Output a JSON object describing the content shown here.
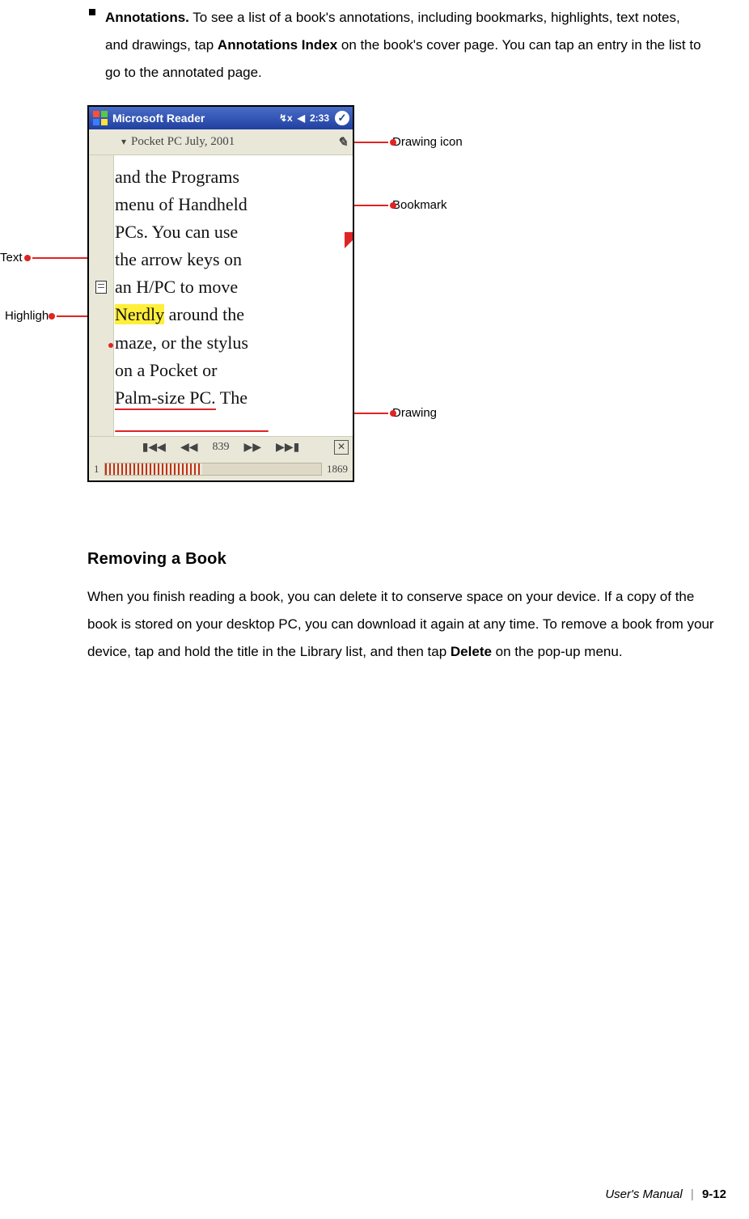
{
  "bullet": {
    "label": "Annotations.",
    "text_before": " To see a list of a book's annotations, including bookmarks, highlights, text notes, and drawings, tap ",
    "bold_cmd": "Annotations Index",
    "text_after": " on the book's cover page. You can tap an entry in the list to go to the annotated page."
  },
  "device": {
    "titlebar": {
      "app_name": "Microsoft Reader",
      "time": "2:33",
      "conn_icon": "↯x",
      "volume_icon": "◀"
    },
    "book_header_arrow": "▾",
    "book_header": "Pocket PC July, 2001",
    "pen_glyph": "✎",
    "text_line1": "and the Programs",
    "text_line2": "menu of Handheld",
    "text_line3": "PCs. You can use",
    "text_line4": "the arrow keys on",
    "text_line5": "an H/PC to move",
    "text_hl_word": "Nerdly",
    "text_line6_rest": " around the",
    "text_line7": "maze, or the stylus",
    "text_line8": "on a Pocket or",
    "text_underlined": "Palm-size PC.",
    "text_line9_rest": " The",
    "nav_first": "▮◀◀",
    "nav_back": "◀◀",
    "nav_page": "839",
    "nav_fwd": "▶▶",
    "nav_last": "▶▶▮",
    "nav_close": "✕",
    "prog_start": "1",
    "prog_end": "1869",
    "prog_fill_pct": "45%"
  },
  "callouts": {
    "drawing_icon": "Drawing icon",
    "bookmark": "Bookmark",
    "text": "Text",
    "highlight": "Highligh",
    "drawing": "Drawing"
  },
  "section2": {
    "heading": "Removing a Book",
    "p_before": "When you finish reading a book, you can delete it to conserve space on your device. If a copy of the book is stored on your desktop PC, you can download it again at any time. To remove a book from your device, tap and hold the title in the Library list, and then tap ",
    "bold": "Delete",
    "p_after": " on the pop-up menu."
  },
  "footer": {
    "title": "User's Manual",
    "page": "9-12"
  }
}
